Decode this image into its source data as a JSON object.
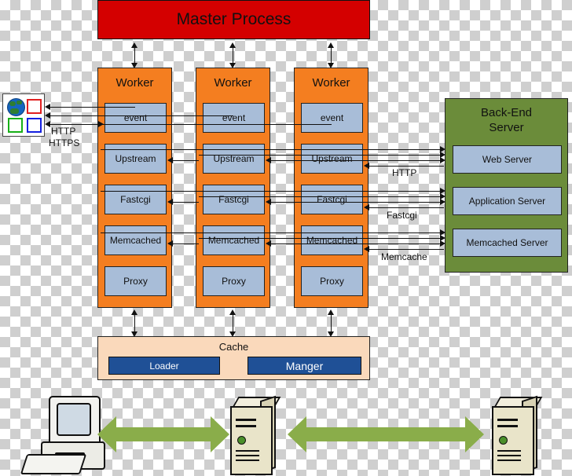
{
  "diagram": {
    "title": "Master Process",
    "master": {
      "label": "Master Process",
      "color": "#d40000"
    },
    "workers": [
      {
        "title": "Worker",
        "modules": [
          "event",
          "Upstream",
          "Fastcgi",
          "Memcached",
          "Proxy"
        ]
      },
      {
        "title": "Worker",
        "modules": [
          "event",
          "Upstream",
          "Fastcgi",
          "Memcached",
          "Proxy"
        ]
      },
      {
        "title": "Worker",
        "modules": [
          "event",
          "Upstream",
          "Fastcgi",
          "Memcached",
          "Proxy"
        ]
      }
    ],
    "backend": {
      "title_line1": "Back-End",
      "title_line2": "Server",
      "color": "#6b8c3a",
      "services": [
        "Web Server",
        "Application Server",
        "Memcached Server"
      ]
    },
    "cache": {
      "title": "Cache",
      "color": "#fad9bb",
      "items": [
        "Loader",
        "Manger"
      ],
      "item_color": "#1f5096"
    },
    "client_labels": {
      "http": "HTTP",
      "https": "HTTPS"
    },
    "protocol_labels": {
      "http": "HTTP",
      "fastcgi": "Fastcgi",
      "memcache": "Memcache"
    },
    "icons": {
      "browser": "web-browser-icon",
      "globe": "globe-icon",
      "desktop": "desktop-computer-icon",
      "server_left": "server-tower-icon",
      "server_right": "server-tower-icon",
      "arrow": "double-headed-arrow"
    },
    "colors": {
      "worker": "#f47e20",
      "module": "#a8bdd8",
      "green_arrow": "#8aad4a"
    }
  }
}
